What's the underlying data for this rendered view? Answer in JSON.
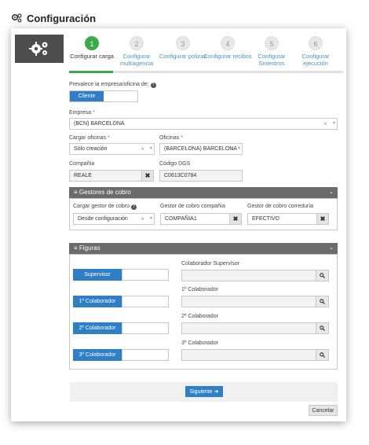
{
  "header": {
    "title": "Configuración",
    "icon": "gears-icon"
  },
  "wizard": {
    "steps": [
      {
        "number": "1",
        "label": "Configurar carga"
      },
      {
        "number": "2",
        "label": "Configurar multiagencia"
      },
      {
        "number": "3",
        "label": "Configurar pólizas"
      },
      {
        "number": "4",
        "label": "Configurar recibos"
      },
      {
        "number": "5",
        "label": "Configurar Siniestros"
      },
      {
        "number": "6",
        "label": "Configurar ejecución"
      }
    ],
    "active_step": 1,
    "progress_percent": 16
  },
  "form": {
    "prevalece_label": "Prevalece la empresa/oficina de:",
    "prevalece_value": "Cliente",
    "empresa_label": "Empresa",
    "empresa_value": "(BCN) BARCELONA",
    "cargar_oficinas_label": "Cargar oficinas",
    "cargar_oficinas_value": "Sólo creación",
    "oficinas_label": "Oficinas",
    "oficinas_value": "(BARCELONA) BARCELONA",
    "compania_label": "Compañía",
    "compania_value": "REALE",
    "codigo_dgs_label": "Código DGS",
    "codigo_dgs_value": "C0613C0784"
  },
  "gestores": {
    "title": "Gestores de cobro",
    "cargar_label": "Cargar gestor de cobro",
    "cargar_value": "Desde configuración",
    "compania_label": "Gestor de cobro compañía",
    "compania_value": "COMPAÑIA1",
    "correduria_label": "Gestor de cobro correduría",
    "correduria_value": "EFECTIVO"
  },
  "figuras": {
    "title": "Figuras",
    "buttons": [
      "Supervisor",
      "1º Colaborador",
      "2º Colaborador",
      "3º Colaborador"
    ],
    "labels": [
      "Colaborador Supervisor",
      "1º Colaborador",
      "2º Colaborador",
      "3º Colaborador"
    ]
  },
  "footer": {
    "next_label": "Siguiente",
    "cancel_label": "Cancelar"
  },
  "colors": {
    "accent": "#2f7fc8",
    "active_step": "#3aaa4a",
    "section_header": "#6b6b6b"
  }
}
